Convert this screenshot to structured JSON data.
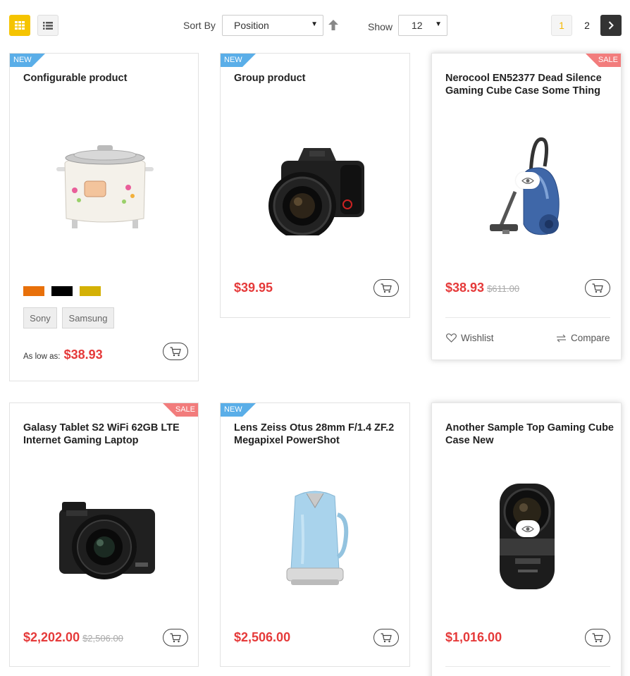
{
  "toolbar": {
    "sort_label": "Sort By",
    "sort_value": "Position",
    "show_label": "Show",
    "limit_value": "12",
    "pages": [
      "1",
      "2"
    ],
    "current_page": "1"
  },
  "colors": {
    "accent": "#f5c400",
    "price": "#e53a3a",
    "new_badge": "#5aaee8",
    "sale_badge": "#f27c7c"
  },
  "products": [
    {
      "badge": "NEW",
      "title": "Configurable product",
      "image": "rice-cooker",
      "swatches": [
        "#e8700a",
        "#000000",
        "#d4b106"
      ],
      "options": [
        "Sony",
        "Samsung"
      ],
      "as_low_as_label": "As low as:",
      "price": "$38.93"
    },
    {
      "badge": "NEW",
      "title": "Group product",
      "image": "dslr-camera",
      "price": "$39.95"
    },
    {
      "badge": "SALE",
      "title": "Nerocool EN52377 Dead Silence Gaming Cube Case Some Thing",
      "image": "vacuum-cleaner",
      "price": "$38.93",
      "old_price": "$611.00",
      "wishlist_label": "Wishlist",
      "compare_label": "Compare"
    },
    {
      "badge": "SALE",
      "title": "Galasy Tablet S2 WiFi 62GB LTE Internet Gaming Laptop",
      "image": "compact-camera",
      "price": "$2,202.00",
      "old_price": "$2,506.00"
    },
    {
      "badge": "NEW",
      "title": "Lens Zeiss Otus 28mm F/1.4 ZF.2 Megapixel PowerShot",
      "image": "blue-kettle",
      "price": "$2,506.00"
    },
    {
      "title": "Another Sample Top Gaming Cube Case New",
      "image": "action-camera",
      "price": "$1,016.00"
    }
  ]
}
